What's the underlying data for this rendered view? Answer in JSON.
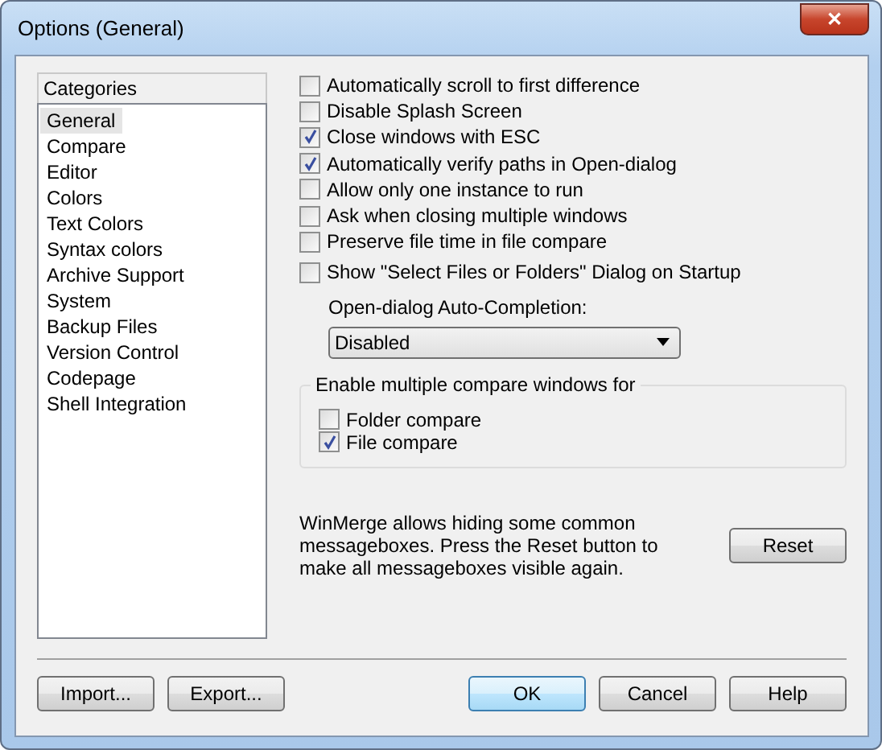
{
  "window": {
    "title": "Options (General)",
    "close_label": "✕"
  },
  "categories": {
    "header": "Categories",
    "items": [
      {
        "label": "General",
        "selected": true
      },
      {
        "label": "Compare",
        "selected": false
      },
      {
        "label": "Editor",
        "selected": false
      },
      {
        "label": "Colors",
        "selected": false
      },
      {
        "label": "Text Colors",
        "selected": false
      },
      {
        "label": "Syntax colors",
        "selected": false
      },
      {
        "label": "Archive Support",
        "selected": false
      },
      {
        "label": "System",
        "selected": false
      },
      {
        "label": "Backup Files",
        "selected": false
      },
      {
        "label": "Version Control",
        "selected": false
      },
      {
        "label": "Codepage",
        "selected": false
      },
      {
        "label": "Shell Integration",
        "selected": false
      }
    ]
  },
  "options": [
    {
      "label": "Automatically scroll to first difference",
      "checked": false
    },
    {
      "label": "Disable Splash Screen",
      "checked": false
    },
    {
      "label": "Close windows with ESC",
      "checked": true
    },
    {
      "label": "Automatically verify paths in Open-dialog",
      "checked": true
    },
    {
      "label": "Allow only one instance to run",
      "checked": false
    },
    {
      "label": "Ask when closing multiple windows",
      "checked": false
    },
    {
      "label": "Preserve file time in file compare",
      "checked": false
    },
    {
      "label": "Show \"Select Files or Folders\" Dialog on Startup",
      "checked": false
    }
  ],
  "autocomplete": {
    "label": "Open-dialog Auto-Completion:",
    "value": "Disabled"
  },
  "multi_compare": {
    "title": "Enable multiple compare windows for",
    "options": [
      {
        "label": "Folder compare",
        "checked": false
      },
      {
        "label": "File compare",
        "checked": true
      }
    ]
  },
  "reset_note": "WinMerge allows hiding some common messageboxes. Press the Reset button to make all messageboxes visible again.",
  "reset_button": "Reset",
  "left_buttons": [
    "Import...",
    "Export..."
  ],
  "right_buttons": [
    {
      "label": "OK",
      "default": true
    },
    {
      "label": "Cancel",
      "default": false
    },
    {
      "label": "Help",
      "default": false
    }
  ]
}
